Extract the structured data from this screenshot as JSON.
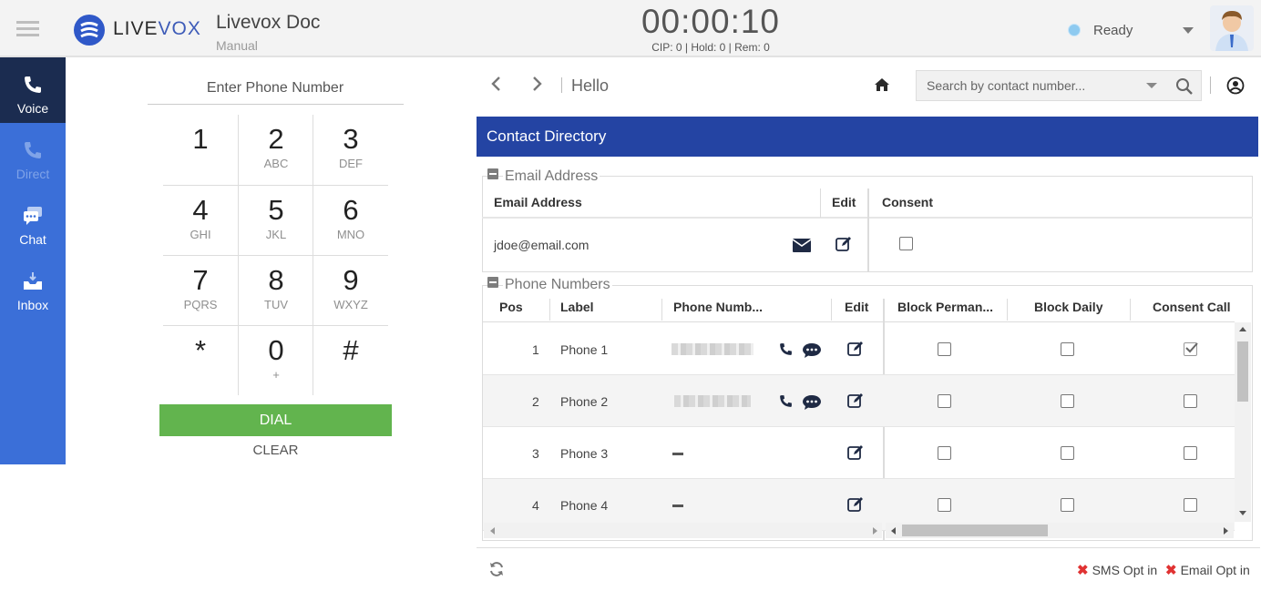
{
  "header": {
    "logo_text_1": "LIVE",
    "logo_text_2": "VOX",
    "app_title": "Livevox Doc",
    "app_subtitle": "Manual",
    "timer": "00:00:10",
    "stats": "CIP: 0 | Hold: 0 | Rem: 0",
    "status_label": "Ready",
    "status_color": "#8ecaf0"
  },
  "sidebar": {
    "items": [
      {
        "label": "Voice",
        "icon": "phone-icon",
        "state": "active"
      },
      {
        "label": "Direct",
        "icon": "phone-icon",
        "state": "disabled"
      },
      {
        "label": "Chat",
        "icon": "chat-icon",
        "state": "normal"
      },
      {
        "label": "Inbox",
        "icon": "inbox-icon",
        "state": "normal"
      }
    ],
    "color": "#3b6fd8",
    "active_color": "#1b2c50"
  },
  "dialer": {
    "label": "Enter Phone Number",
    "keys": [
      {
        "digit": "1",
        "letters": ""
      },
      {
        "digit": "2",
        "letters": "ABC"
      },
      {
        "digit": "3",
        "letters": "DEF"
      },
      {
        "digit": "4",
        "letters": "GHI"
      },
      {
        "digit": "5",
        "letters": "JKL"
      },
      {
        "digit": "6",
        "letters": "MNO"
      },
      {
        "digit": "7",
        "letters": "PQRS"
      },
      {
        "digit": "8",
        "letters": "TUV"
      },
      {
        "digit": "9",
        "letters": "WXYZ"
      },
      {
        "digit": "*",
        "letters": ""
      },
      {
        "digit": "0",
        "letters": "+"
      },
      {
        "digit": "#",
        "letters": ""
      }
    ],
    "dial_label": "DIAL",
    "clear_label": "CLEAR",
    "dial_color": "#62b44e"
  },
  "main": {
    "breadcrumb": "Hello",
    "search_placeholder": "Search by contact number...",
    "directory_title": "Contact Directory",
    "directory_color": "#2444a3",
    "email_section": {
      "legend": "Email Address",
      "headers": [
        "Email Address",
        "Edit",
        "Consent"
      ],
      "rows": [
        {
          "email": "jdoe@email.com",
          "consent": false
        }
      ]
    },
    "phone_section": {
      "legend": "Phone Numbers",
      "headers": [
        "Pos",
        "Label",
        "Phone Numb...",
        "Edit",
        "Block Perman...",
        "Block Daily",
        "Consent Call"
      ],
      "rows": [
        {
          "pos": "1",
          "label": "Phone 1",
          "has_number": true,
          "block_perm": false,
          "block_daily": false,
          "consent_call": true
        },
        {
          "pos": "2",
          "label": "Phone 2",
          "has_number": true,
          "block_perm": false,
          "block_daily": false,
          "consent_call": false
        },
        {
          "pos": "3",
          "label": "Phone 3",
          "has_number": false,
          "block_perm": false,
          "block_daily": false,
          "consent_call": false
        },
        {
          "pos": "4",
          "label": "Phone 4",
          "has_number": false,
          "block_perm": false,
          "block_daily": false,
          "consent_call": false
        }
      ]
    },
    "footer": {
      "sms_optin": "SMS Opt in",
      "email_optin": "Email Opt in"
    }
  }
}
